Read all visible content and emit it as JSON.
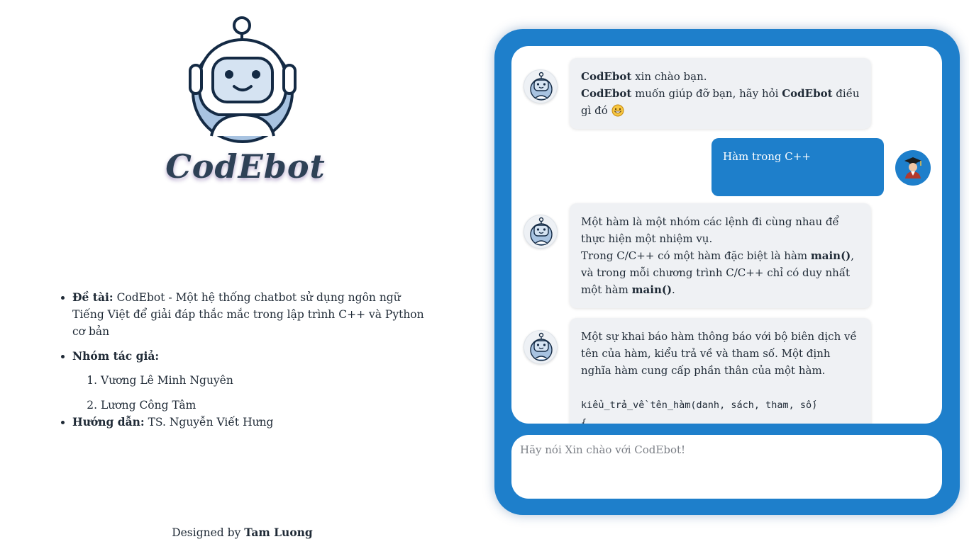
{
  "brand": {
    "name": "CodEbot"
  },
  "info": {
    "topic_label": "Đề tài:",
    "topic_text": "CodEbot - Một hệ thống chatbot sử dụng ngôn ngữ Tiếng Việt để giải đáp thắc mắc trong lập trình C++ và Python cơ bản",
    "authors_label": "Nhóm tác giả:",
    "authors": [
      "Vương Lê Minh Nguyên",
      "Lương Công Tâm"
    ],
    "advisor_label": "Hướng dẫn:",
    "advisor_text": "TS. Nguyễn Viết Hưng"
  },
  "footer": {
    "prefix": "Designed by",
    "author": "Tam Luong"
  },
  "chat": {
    "greeting": {
      "name1": "CodEbot",
      "line1": " xin chào bạn.",
      "name2": "CodEbot",
      "line2a": " muốn giúp đỡ bạn, hãy hỏi ",
      "name3": "CodEbot",
      "line2b": " điều gì đó ",
      "emoji": "grinning-emoji"
    },
    "user_message": "Hàm trong C++",
    "answer1": {
      "p1": "Một hàm là một nhóm các lệnh đi cùng nhau để thực hiện một nhiệm vụ.",
      "p2a": "Trong C/C++ có một hàm đặc biệt là hàm ",
      "main1": "main()",
      "p2b": ", và trong mỗi chương trình C/C++ chỉ có duy nhất một hàm ",
      "main2": "main()",
      "p2c": "."
    },
    "answer2": {
      "p1": "Một sự khai báo hàm thông báo với bộ biên dịch về tên của hàm, kiểu trả về và tham số. Một định nghĩa hàm cung cấp phần thân của một hàm.",
      "code1": "kiểu_trả_về tên_hàm(danh, sách, tham, số)",
      "code2": "{"
    },
    "input_placeholder": "Hãy nói Xin chào với CodEbot!"
  },
  "colors": {
    "accent": "#1e7fcb",
    "bot_bubble": "#eff1f4",
    "text": "#1f2a36"
  },
  "icons": {
    "bot": "robot-icon",
    "user": "graduate-user-icon"
  }
}
